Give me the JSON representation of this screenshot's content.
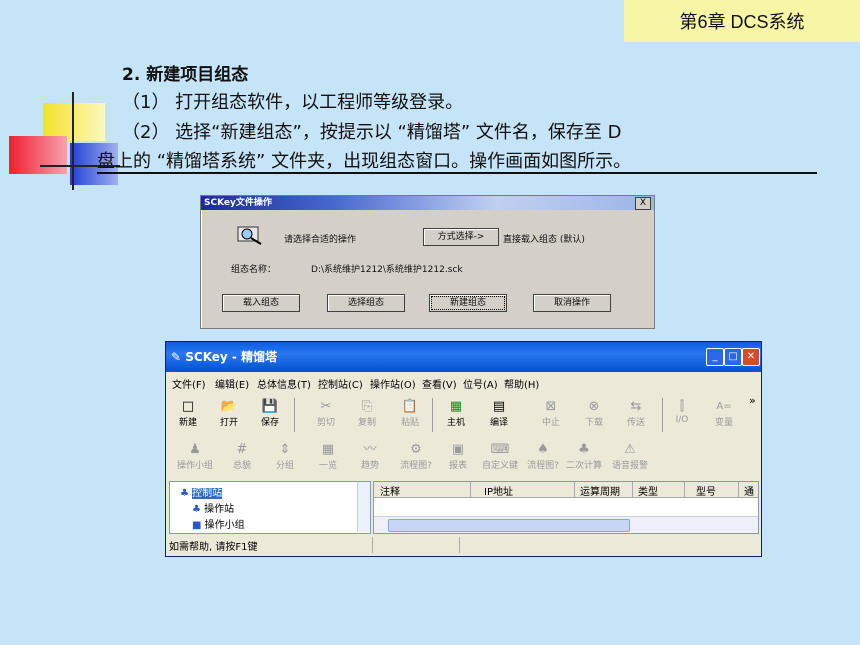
{
  "chapter": "第6章 DCS系统",
  "heading": "2. 新建项目组态",
  "steps": {
    "s1": "（1） 打开组态软件，以工程师等级登录。",
    "s2a": "（2） 选择“新建组态”，按提示以 “精馏塔” 文件名，保存至 D",
    "s2b": "盘上的 “精馏塔系统” 文件夹，出现组态窗口。操作画面如图所示。"
  },
  "dialog": {
    "title": "SCKey文件操作",
    "close": "X",
    "prompt": "请选择合适的操作",
    "mode_button": "方式选择->",
    "mode_desc": "直接载入组态 (默认)",
    "name_label": "组态名称：",
    "name_value": "D:\\系统维护1212\\系统维护1212.sck",
    "buttons": [
      "载入组态",
      "选择组态",
      "新建组态",
      "取消操作"
    ]
  },
  "window": {
    "title": "SCKey - 精馏塔",
    "menus": [
      "文件(F)",
      "编辑(E)",
      "总体信息(T)",
      "控制站(C)",
      "操作站(O)",
      "查看(V)",
      "位号(A)",
      "帮助(H)"
    ],
    "toolbar1": [
      "新建",
      "打开",
      "保存",
      "剪切",
      "复制",
      "粘贴",
      "主机",
      "编译",
      "中止",
      "下载",
      "传送",
      "I/O",
      "变量"
    ],
    "toolbar1_icons": [
      "□",
      "📂",
      "💾",
      "✂",
      "⎘",
      "📋",
      "▦",
      "▤",
      "⊠",
      "⊗",
      "⇆",
      "⫿",
      "A="
    ],
    "toolbar2": [
      "操作小组",
      "总貌",
      "分组",
      "一览",
      "趋势",
      "流程图?",
      "报表",
      "自定义键",
      "流程图?",
      "二次计算",
      "语音报警"
    ],
    "toolbar2_icons": [
      "♟",
      "#",
      "⇕",
      "▦",
      "〰",
      "⚙",
      "▣",
      "⌨",
      "♠",
      "♣",
      "⚠"
    ],
    "more": "»",
    "tree": [
      "控制站",
      "操作站",
      "操作小组"
    ],
    "columns": [
      "注释",
      "IP地址",
      "运算周期",
      "类型",
      "型号",
      "通"
    ],
    "status": "如需帮助, 请按F1键"
  }
}
